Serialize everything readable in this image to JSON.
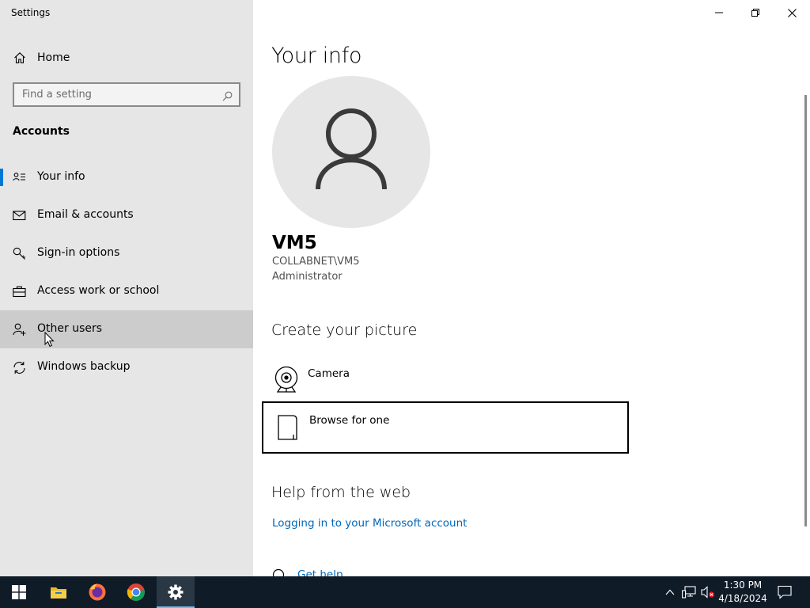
{
  "window": {
    "title": "Settings",
    "controls": [
      "minimize",
      "restore",
      "close"
    ]
  },
  "sidebar": {
    "home_label": "Home",
    "search_placeholder": "Find a setting",
    "section_label": "Accounts",
    "items": [
      {
        "label": "Your info",
        "icon": "person-card-icon",
        "selected": true
      },
      {
        "label": "Email & accounts",
        "icon": "mail-icon"
      },
      {
        "label": "Sign-in options",
        "icon": "key-icon"
      },
      {
        "label": "Access work or school",
        "icon": "briefcase-icon"
      },
      {
        "label": "Other users",
        "icon": "add-person-icon",
        "hovered": true
      },
      {
        "label": "Windows backup",
        "icon": "sync-icon"
      }
    ]
  },
  "main": {
    "title": "Your info",
    "user": {
      "name": "VM5",
      "account": "COLLABNET\\VM5",
      "role": "Administrator"
    },
    "create_picture": {
      "heading": "Create your picture",
      "options": [
        {
          "label": "Camera",
          "icon": "webcam-icon"
        },
        {
          "label": "Browse for one",
          "icon": "document-icon",
          "focused": true
        }
      ]
    },
    "help": {
      "heading": "Help from the web",
      "link": "Logging in to your Microsoft account",
      "get_help": "Get help"
    }
  },
  "taskbar": {
    "apps": [
      "start-icon",
      "file-explorer-icon",
      "firefox-icon",
      "chrome-icon",
      "settings-icon"
    ],
    "active_app": "settings-icon",
    "tray_icons": [
      "chevron-up-icon",
      "network-icon",
      "volume-muted-icon",
      "notifications-icon"
    ],
    "time": "1:30 PM",
    "date": "4/18/2024"
  },
  "colors": {
    "accent": "#0078d7",
    "link": "#0067b8",
    "sidebar_bg": "#e6e6e6",
    "taskbar_bg": "#101b28"
  }
}
